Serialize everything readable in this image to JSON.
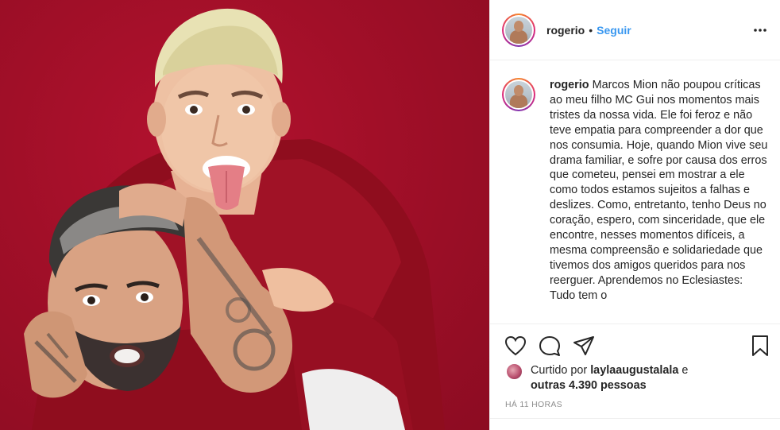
{
  "post": {
    "image_description_icon": "photo-of-two-people-icon"
  },
  "header": {
    "username": "rogerio",
    "separator": "•",
    "follow_label": "Seguir",
    "more_icon": "more-horizontal-icon"
  },
  "caption": {
    "username": "rogerio",
    "text": "Marcos Mion não poupou críticas ao meu filho MC Gui nos momentos mais tristes da nossa vida. Ele foi feroz e não teve empatia para compreender a dor que nos consumia. Hoje, quando Mion vive seu drama familiar, e sofre por causa dos erros que cometeu, pensei em mostrar a ele como todos estamos sujeitos a falhas e deslizes. Como, entretanto, tenho Deus no coração, espero, com sinceridade, que ele encontre, nesses momentos difíceis, a mesma compreensão e solidariedade que tivemos dos amigos queridos para nos reerguer. Aprendemos no Eclesiastes: Tudo tem o"
  },
  "actions": {
    "like_icon": "heart-icon",
    "comment_icon": "comment-bubble-icon",
    "share_icon": "paper-plane-icon",
    "save_icon": "bookmark-icon"
  },
  "likes": {
    "prefix": "Curtido por ",
    "liker": "laylaaugustalala",
    "middle": " e",
    "others": "outras 4.390 pessoas"
  },
  "timestamp": "HÁ 11 HORAS",
  "colors": {
    "link_blue": "#3897f0",
    "text": "#262626",
    "muted": "#8e8e8e",
    "divider": "#efefef",
    "photo_background": "#a10f28"
  }
}
